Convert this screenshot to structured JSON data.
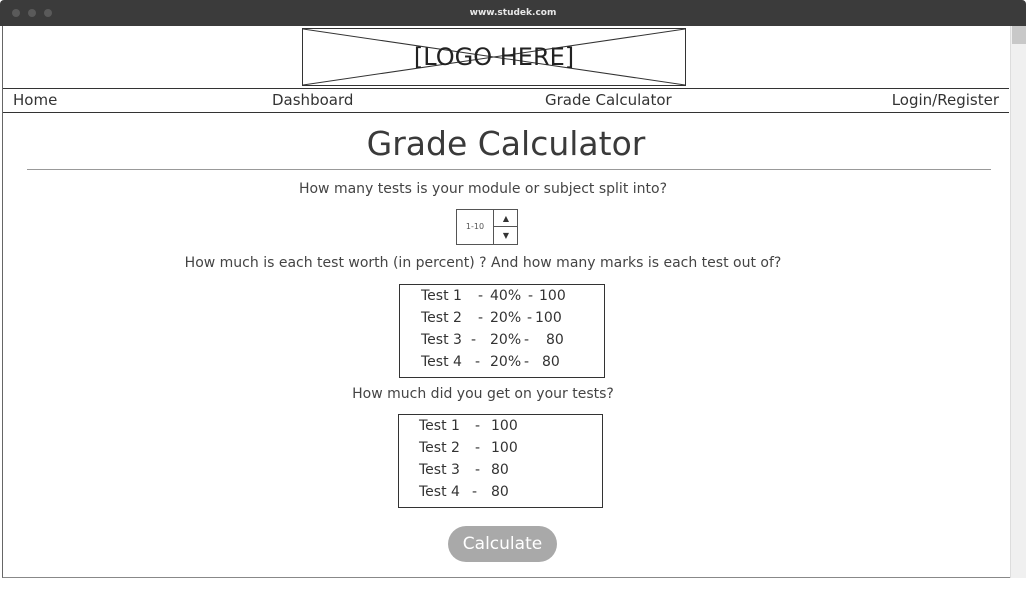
{
  "browser": {
    "url": "www.studek.com"
  },
  "header": {
    "logo_text": "[LOGO HERE]"
  },
  "nav": {
    "home": "Home",
    "dashboard": "Dashboard",
    "grade_calculator": "Grade Calculator",
    "login": "Login/Register"
  },
  "page": {
    "title": "Grade Calculator"
  },
  "q1": {
    "text": "How many tests is your module or subject split into?",
    "stepper_value": "1-10"
  },
  "q2": {
    "text": "How much is each test worth (in percent) ? And how many marks is each test out of?",
    "rows": [
      {
        "test": "Test 1",
        "weight": "40%",
        "marks": "100"
      },
      {
        "test": "Test 2",
        "weight": "20%",
        "marks": "100"
      },
      {
        "test": "Test 3",
        "weight": "20%",
        "marks": "80"
      },
      {
        "test": "Test 4",
        "weight": "20%",
        "marks": "80"
      }
    ]
  },
  "q3": {
    "text": "How much did you get on your tests?",
    "rows": [
      {
        "test": "Test 1",
        "score": "100"
      },
      {
        "test": "Test 2",
        "score": "100"
      },
      {
        "test": "Test 3",
        "score": "80"
      },
      {
        "test": "Test 4",
        "score": "80"
      }
    ]
  },
  "actions": {
    "calculate": "Calculate"
  }
}
